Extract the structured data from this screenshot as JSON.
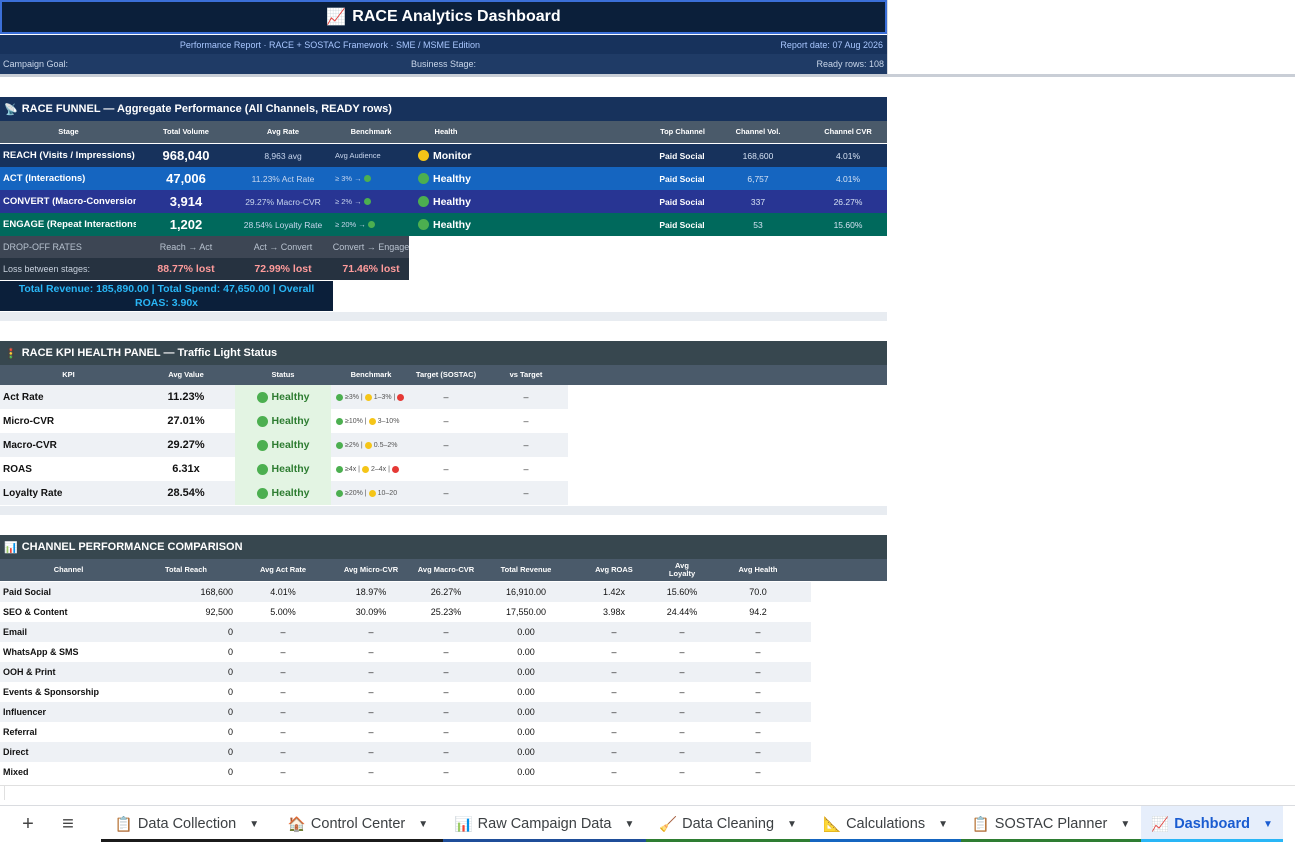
{
  "header": {
    "title": "RACE Analytics Dashboard",
    "title_icon": "chart-increasing-icon",
    "subtitle": "Performance Report · RACE + SOSTAC Framework · SME / MSME Edition",
    "report_date": "Report date: 07 Aug 2026",
    "campaign_goal": "Campaign Goal:",
    "business_stage": "Business Stage:",
    "ready_rows": "Ready rows: 108"
  },
  "funnel": {
    "title": "RACE FUNNEL — Aggregate Performance (All Channels, READY rows)",
    "columns": [
      "Stage",
      "Total Volume",
      "Avg Rate",
      "Benchmark",
      "Health",
      "Top Channel",
      "Channel Vol.",
      "Channel CVR"
    ],
    "rows": [
      {
        "stage": "REACH (Visits / Impressions)",
        "volume": "968,040",
        "rate": "8,963 avg",
        "benchmark": "Avg Audience",
        "health": "Monitor",
        "health_color": "yellow",
        "top_channel": "Paid Social",
        "channel_vol": "168,600",
        "channel_cvr": "4.01%",
        "bg": "#17325c"
      },
      {
        "stage": "ACT (Interactions)",
        "volume": "47,006",
        "rate": "11.23% Act Rate",
        "benchmark": "≥ 3% → ",
        "health": "Healthy",
        "health_color": "green",
        "top_channel": "Paid Social",
        "channel_vol": "6,757",
        "channel_cvr": "4.01%",
        "bg": "#1565c0"
      },
      {
        "stage": "CONVERT (Macro-Conversions)",
        "volume": "3,914",
        "rate": "29.27% Macro-CVR",
        "benchmark": "≥ 2% → ",
        "health": "Healthy",
        "health_color": "green",
        "top_channel": "Paid Social",
        "channel_vol": "337",
        "channel_cvr": "26.27%",
        "bg": "#283593"
      },
      {
        "stage": "ENGAGE (Repeat Interactions)",
        "volume": "1,202",
        "rate": "28.54% Loyalty Rate",
        "benchmark": "≥ 20% → ",
        "health": "Healthy",
        "health_color": "green",
        "top_channel": "Paid Social",
        "channel_vol": "53",
        "channel_cvr": "15.60%",
        "bg": "#00695c"
      }
    ],
    "dropoff": {
      "label": "DROP-OFF RATES",
      "headers": [
        "Reach → Act",
        "Act → Convert",
        "Convert → Engage"
      ],
      "loss_label": "Loss between stages:",
      "values": [
        "88.77% lost",
        "72.99% lost",
        "71.46% lost"
      ]
    },
    "revenue_line1": "Total Revenue: 185,890.00  |  Total Spend: 47,650.00  |  Overall",
    "revenue_line2": "ROAS: 3.90x"
  },
  "kpi": {
    "title": "RACE KPI HEALTH PANEL — Traffic Light Status",
    "columns": [
      "KPI",
      "Avg Value",
      "Status",
      "Benchmark",
      "Target (SOSTAC)",
      "vs Target"
    ],
    "rows": [
      {
        "kpi": "Act Rate",
        "value": "11.23%",
        "status": "Healthy",
        "bench": "≥3% | ",
        "bench2": "1–3% | ",
        "target": "–",
        "vs": "–"
      },
      {
        "kpi": "Micro-CVR",
        "value": "27.01%",
        "status": "Healthy",
        "bench": "≥10% | ",
        "bench2": "3–10%",
        "target": "–",
        "vs": "–"
      },
      {
        "kpi": "Macro-CVR",
        "value": "29.27%",
        "status": "Healthy",
        "bench": "≥2% | ",
        "bench2": "0.5–2%",
        "target": "–",
        "vs": "–"
      },
      {
        "kpi": "ROAS",
        "value": "6.31x",
        "status": "Healthy",
        "bench": "≥4x | ",
        "bench2": "2–4x | ",
        "target": "–",
        "vs": "–"
      },
      {
        "kpi": "Loyalty Rate",
        "value": "28.54%",
        "status": "Healthy",
        "bench": "≥20% | ",
        "bench2": "10–20",
        "target": "–",
        "vs": "–"
      }
    ]
  },
  "channels": {
    "title": "CHANNEL PERFORMANCE COMPARISON",
    "columns": [
      "Channel",
      "Total Reach",
      "Avg Act Rate",
      "Avg Micro-CVR",
      "Avg Macro-CVR",
      "Total Revenue",
      "Avg ROAS",
      "Avg Loyalty",
      "Avg Health"
    ],
    "rows": [
      [
        "Paid Social",
        "168,600",
        "4.01%",
        "18.97%",
        "26.27%",
        "16,910.00",
        "1.42x",
        "15.60%",
        "70.0"
      ],
      [
        "SEO & Content",
        "92,500",
        "5.00%",
        "30.09%",
        "25.23%",
        "17,550.00",
        "3.98x",
        "24.44%",
        "94.2"
      ],
      [
        "Email",
        "0",
        "–",
        "–",
        "–",
        "0.00",
        "–",
        "–",
        "–"
      ],
      [
        "WhatsApp & SMS",
        "0",
        "–",
        "–",
        "–",
        "0.00",
        "–",
        "–",
        "–"
      ],
      [
        "OOH & Print",
        "0",
        "–",
        "–",
        "–",
        "0.00",
        "–",
        "–",
        "–"
      ],
      [
        "Events & Sponsorship",
        "0",
        "–",
        "–",
        "–",
        "0.00",
        "–",
        "–",
        "–"
      ],
      [
        "Influencer",
        "0",
        "–",
        "–",
        "–",
        "0.00",
        "–",
        "–",
        "–"
      ],
      [
        "Referral",
        "0",
        "–",
        "–",
        "–",
        "0.00",
        "–",
        "–",
        "–"
      ],
      [
        "Direct",
        "0",
        "–",
        "–",
        "–",
        "0.00",
        "–",
        "–",
        "–"
      ],
      [
        "Mixed",
        "0",
        "–",
        "–",
        "–",
        "0.00",
        "–",
        "–",
        "–"
      ]
    ]
  },
  "tabs": [
    {
      "label": "Data Collection",
      "icon": "clipboard-icon",
      "glyph": "📋",
      "color": "#1b1b1b"
    },
    {
      "label": "Control Center",
      "icon": "house-icon",
      "glyph": "🏠",
      "color": "#1b1b1b"
    },
    {
      "label": "Raw Campaign Data",
      "icon": "bar-chart-icon",
      "glyph": "📊",
      "color": "#1f4e99"
    },
    {
      "label": "Data Cleaning",
      "icon": "broom-icon",
      "glyph": "🧹",
      "color": "#2e7d32"
    },
    {
      "label": "Calculations",
      "icon": "ruler-icon",
      "glyph": "📐",
      "color": "#1565c0"
    },
    {
      "label": "SOSTAC Planner",
      "icon": "clipboard-icon",
      "glyph": "📋",
      "color": "#2e7d32"
    },
    {
      "label": "Dashboard",
      "icon": "chart-increasing-icon",
      "glyph": "📈",
      "color": "#29b6f6",
      "active": true
    }
  ],
  "colors": {
    "navy": "#0b1f3a",
    "header_grey": "#4a5a6a",
    "healthy": "#4caf50",
    "monitor": "#f5c518"
  }
}
